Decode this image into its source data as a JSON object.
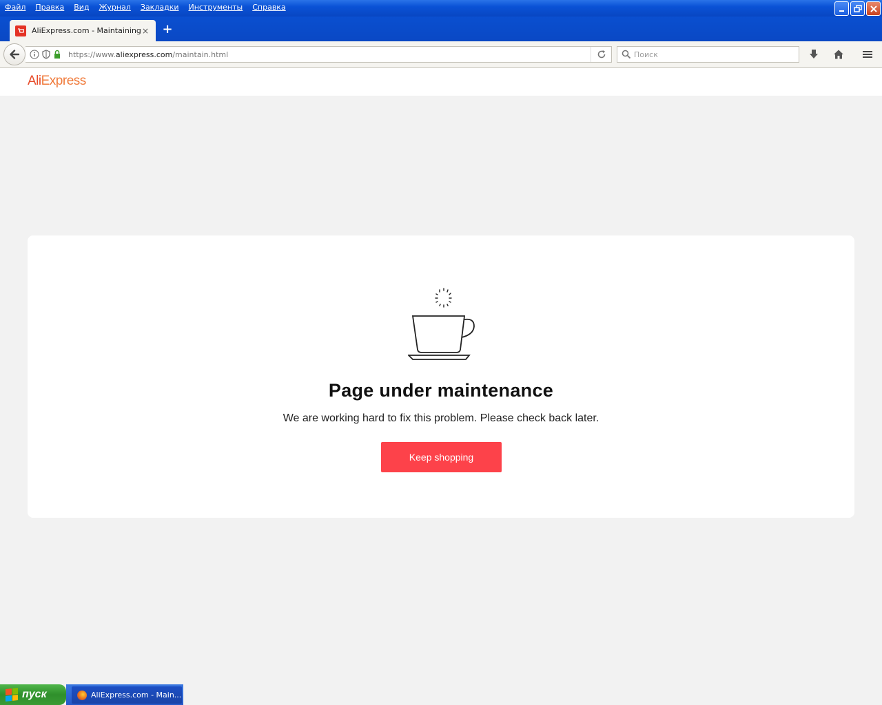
{
  "window": {
    "menu": [
      "Файл",
      "Правка",
      "Вид",
      "Журнал",
      "Закладки",
      "Инструменты",
      "Справка"
    ]
  },
  "tab": {
    "title": "AliExpress.com - Maintaining",
    "close": "×",
    "new_tab": "+"
  },
  "navbar": {
    "url_prefix": "https://www.",
    "url_domain": "aliexpress.com",
    "url_path": "/maintain.html",
    "search_placeholder": "Поиск"
  },
  "page": {
    "logo_ali": "Ali",
    "logo_express": "Express",
    "title": "Page under maintenance",
    "subtitle": "We are working hard to fix this problem. Please check back later.",
    "button": "Keep shopping"
  },
  "taskbar": {
    "start_label": "пуск",
    "task_label": "AliExpress.com - Main..."
  },
  "colors": {
    "accent_button": "#fd424a",
    "logo": "#e84e2c"
  }
}
